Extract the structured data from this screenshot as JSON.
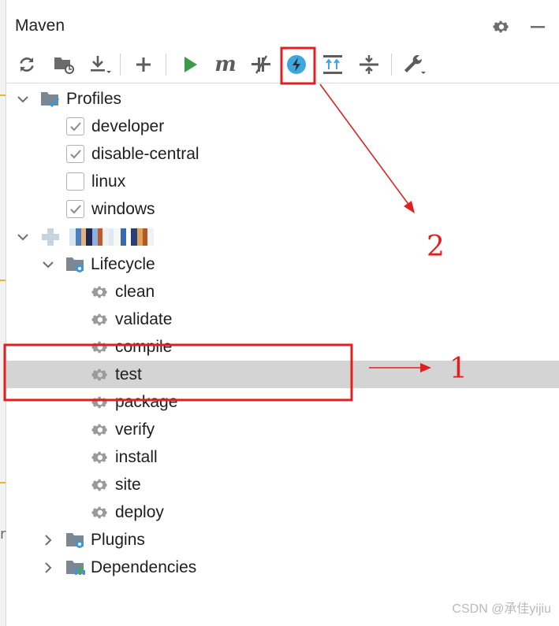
{
  "window": {
    "title": "Maven"
  },
  "header": {
    "settings_icon": "gear-icon",
    "minimize_icon": "minus-icon"
  },
  "toolbar": {
    "buttons": [
      {
        "name": "reload-all-button",
        "icon": "reload-icon"
      },
      {
        "name": "generate-sources-button",
        "icon": "folder-refresh-icon"
      },
      {
        "name": "download-sources-button",
        "icon": "download-icon"
      },
      {
        "name": "add-project-button",
        "icon": "plus-icon"
      },
      {
        "name": "run-button",
        "icon": "play-icon"
      },
      {
        "name": "execute-goal-button",
        "icon": "maven-m-icon"
      },
      {
        "name": "toggle-offline-button",
        "icon": "offline-icon"
      },
      {
        "name": "skip-tests-button",
        "icon": "lightning-icon"
      },
      {
        "name": "show-dependencies-button",
        "icon": "expand-icon"
      },
      {
        "name": "collapse-all-button",
        "icon": "collapse-icon"
      },
      {
        "name": "settings-button",
        "icon": "wrench-icon"
      }
    ]
  },
  "tree": {
    "profiles": {
      "label": "Profiles",
      "items": [
        {
          "label": "developer",
          "checked": true
        },
        {
          "label": "disable-central",
          "checked": true
        },
        {
          "label": "linux",
          "checked": false
        },
        {
          "label": "windows",
          "checked": true
        }
      ]
    },
    "project": {
      "label": "",
      "lifecycle": {
        "label": "Lifecycle",
        "goals": [
          "clean",
          "validate",
          "compile",
          "test",
          "package",
          "verify",
          "install",
          "site",
          "deploy"
        ],
        "selected": "test"
      },
      "plugins": {
        "label": "Plugins"
      },
      "dependencies": {
        "label": "Dependencies"
      }
    }
  },
  "annotations": {
    "label_1": "1",
    "label_2": "2",
    "color": "#e02020"
  },
  "watermark": "CSDN @承佳yijiu"
}
